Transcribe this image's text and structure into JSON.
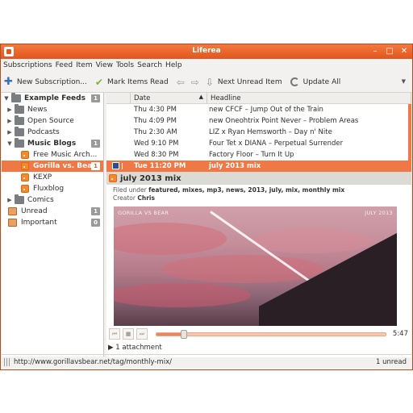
{
  "window": {
    "title": "Liferea"
  },
  "menu": [
    "Subscriptions",
    "Feed",
    "Item",
    "View",
    "Tools",
    "Search",
    "Help"
  ],
  "toolbar": {
    "new_subscription": "New Subscription...",
    "mark_read": "Mark Items Read",
    "next_unread": "Next Unread Item",
    "update_all": "Update All"
  },
  "feeds": [
    {
      "label": "Example Feeds",
      "count": "1"
    },
    {
      "label": "News"
    },
    {
      "label": "Open Source"
    },
    {
      "label": "Podcasts"
    },
    {
      "label": "Music Blogs",
      "count": "1"
    },
    {
      "label": "Free Music Arch..."
    },
    {
      "label": "Gorilla vs. Bear",
      "count": "1"
    },
    {
      "label": "KEXP"
    },
    {
      "label": "Fluxblog"
    },
    {
      "label": "Comics"
    },
    {
      "label": "Unread",
      "count": "1"
    },
    {
      "label": "Important",
      "count": "0"
    }
  ],
  "items": {
    "columns": {
      "date": "Date",
      "headline": "Headline"
    },
    "rows": [
      {
        "date": "Thu 4:30 PM",
        "headline": "new CFCF – Jump Out of the Train"
      },
      {
        "date": "Thu 4:09 PM",
        "headline": "new Oneohtrix Point Never – Problem Areas"
      },
      {
        "date": "Thu 2:30 AM",
        "headline": "LIZ x Ryan Hemsworth – Day n' Nite"
      },
      {
        "date": "Wed 9:10 PM",
        "headline": "Four Tet x DIANA – Perpetual Surrender"
      },
      {
        "date": "Wed 8:30 PM",
        "headline": "Factory Floor – Turn It Up"
      },
      {
        "date": "Tue 11:20 PM",
        "headline": "july 2013 mix"
      }
    ]
  },
  "article": {
    "title": "july 2013 mix",
    "filed_label": "Filed under",
    "tags": "featured, mixes, mp3, news, 2013, july, mix, monthly mix",
    "creator_label": "Creator",
    "creator": "Chris",
    "image_caption_left": "GORILLA VS BEAR",
    "image_caption_right": "JULY 2013",
    "player_time": "5:47",
    "player_progress": 0.12,
    "attachments": "1 attachment"
  },
  "status": {
    "url": "http://www.gorillavsbear.net/tag/monthly-mix/",
    "unread": "1 unread"
  },
  "colors": {
    "accent": "#f07746",
    "titlebar": "#e2561b"
  }
}
